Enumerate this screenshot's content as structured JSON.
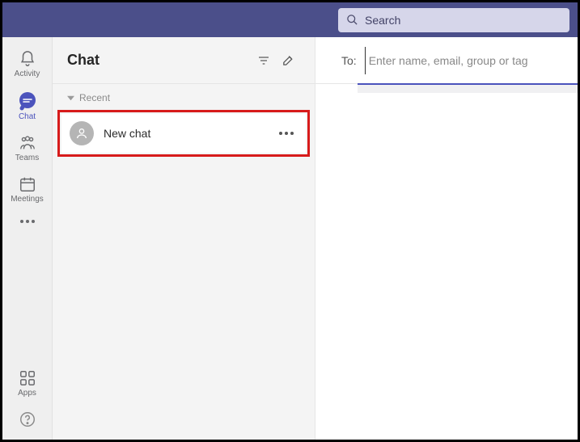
{
  "topbar": {
    "search_placeholder": "Search"
  },
  "rail": {
    "activity": "Activity",
    "chat": "Chat",
    "teams": "Teams",
    "meetings": "Meetings",
    "apps": "Apps"
  },
  "list": {
    "title": "Chat",
    "section_recent": "Recent",
    "items": [
      {
        "name": "New chat"
      }
    ]
  },
  "compose": {
    "to_label": "To:",
    "to_placeholder": "Enter name, email, group or tag"
  }
}
